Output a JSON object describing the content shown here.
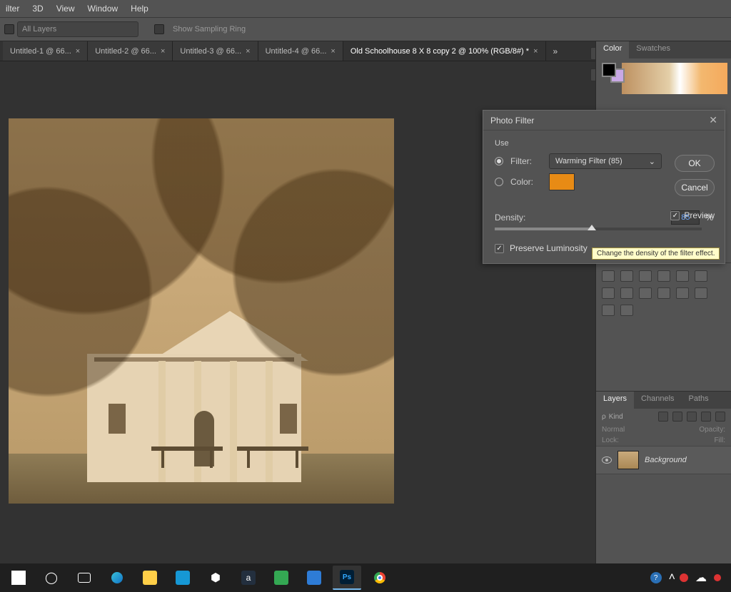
{
  "menu": {
    "items": [
      "ilter",
      "3D",
      "View",
      "Window",
      "Help"
    ]
  },
  "optionsbar": {
    "layers_dd": "All Layers",
    "sampling": "Show Sampling Ring"
  },
  "tabs": [
    {
      "label": "Untitled-1 @ 66...",
      "active": false
    },
    {
      "label": "Untitled-2 @ 66...",
      "active": false
    },
    {
      "label": "Untitled-3 @ 66...",
      "active": false
    },
    {
      "label": "Untitled-4 @ 66...",
      "active": false
    },
    {
      "label": "Old Schoolhouse 8 X 8 copy 2 @ 100% (RGB/8#) *",
      "active": true
    }
  ],
  "tabs_overflow": "»",
  "color_panel": {
    "tabs": [
      "Color",
      "Swatches"
    ],
    "active": 0
  },
  "layers_panel": {
    "tabs": [
      "Layers",
      "Channels",
      "Paths"
    ],
    "active": 0,
    "kind_label": "Kind",
    "blend": "Normal",
    "opacity_label": "Opacity:",
    "lock_label": "Lock:",
    "fill_label": "Fill:",
    "layer0": "Background"
  },
  "dialog": {
    "title": "Photo Filter",
    "use_legend": "Use",
    "filter_label": "Filter:",
    "color_label": "Color:",
    "filter_value": "Warming Filter (85)",
    "density_label": "Density:",
    "density_value": "85",
    "density_unit": "%",
    "preserve_label": "Preserve Luminosity",
    "preview_label": "Preview",
    "ok": "OK",
    "cancel": "Cancel",
    "tooltip": "Change the density of the filter effect.",
    "color_hex": "#e88b15",
    "density_pct": 47
  },
  "search_placeholder": "ρ Kind"
}
